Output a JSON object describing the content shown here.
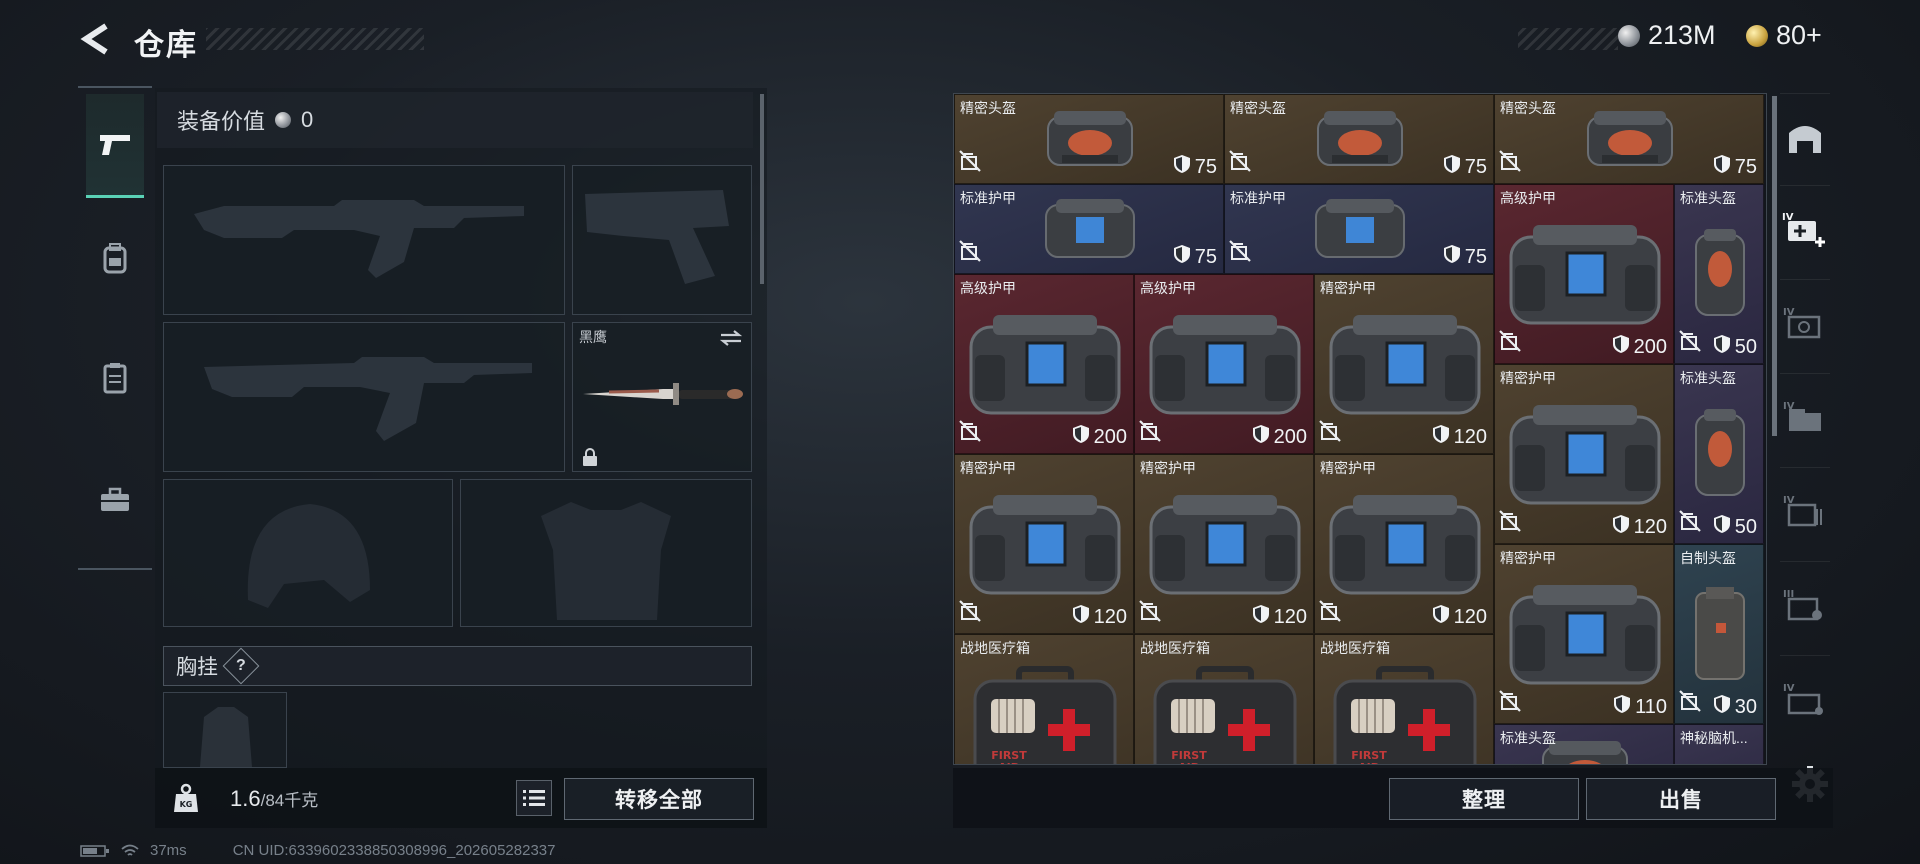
{
  "header": {
    "title": "仓库",
    "currency_silver": "213M",
    "currency_gold": "80+"
  },
  "rail_tabs": [
    {
      "icon": "pistol-icon",
      "active": true
    },
    {
      "icon": "backpack-icon",
      "active": false
    },
    {
      "icon": "vest-icon",
      "active": false
    },
    {
      "icon": "case-icon",
      "active": false
    }
  ],
  "loadout": {
    "value_label": "装备价值",
    "value_amount": "0",
    "melee_slot_label": "黑鹰",
    "chest_label": "胸挂",
    "chest_help": "?",
    "weight_current": "1.6",
    "weight_max": "/84千克",
    "transfer_all": "转移全部"
  },
  "inventory": {
    "items": [
      {
        "name": "精密头盔",
        "durability": "75"
      },
      {
        "name": "精密头盔",
        "durability": "75"
      },
      {
        "name": "精密头盔",
        "durability": "75"
      },
      {
        "name": "标准护甲",
        "durability": "75"
      },
      {
        "name": "标准护甲",
        "durability": "75"
      },
      {
        "name": "高级护甲",
        "durability": "200"
      },
      {
        "name": "标准头盔",
        "durability": "50"
      },
      {
        "name": "高级护甲",
        "durability": "200"
      },
      {
        "name": "高级护甲",
        "durability": "200"
      },
      {
        "name": "精密护甲",
        "durability": "120"
      },
      {
        "name": "精密护甲",
        "durability": "120"
      },
      {
        "name": "标准头盔",
        "durability": "50"
      },
      {
        "name": "精密护甲",
        "durability": "120"
      },
      {
        "name": "精密护甲",
        "durability": "120"
      },
      {
        "name": "精密护甲",
        "durability": "120"
      },
      {
        "name": "精密护甲",
        "durability": "110"
      },
      {
        "name": "自制头盔",
        "durability": "30"
      },
      {
        "name": "战地医疗箱"
      },
      {
        "name": "战地医疗箱"
      },
      {
        "name": "战地医疗箱"
      },
      {
        "name": "标准头盔"
      },
      {
        "name": "神秘脑机..."
      }
    ],
    "medkit_text": "FIRST AID",
    "organize": "整理",
    "sell": "出售"
  },
  "status": {
    "ping": "37ms",
    "uid": "CN UID:6339602338850308996_202605282337"
  },
  "colors": {
    "accent": "#5ad2b6",
    "gold_bg": "#4f4230",
    "blue_bg": "#313650",
    "red_bg": "#5a2730"
  }
}
